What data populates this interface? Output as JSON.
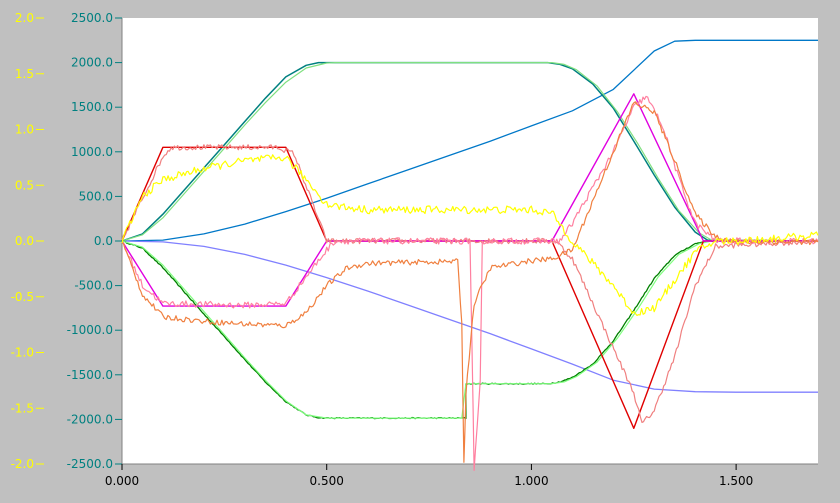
{
  "colors": {
    "background": "#c0c0c0",
    "plot_background": "#ffffff",
    "left_axis_text": "#ffff00",
    "right_axis_text": "#008080",
    "bottom_axis_text": "#000000"
  },
  "chart_data": {
    "type": "line",
    "title": "",
    "xlabel": "",
    "ylabel": "",
    "xlim": [
      0.0,
      1.7
    ],
    "ylim_right": [
      -2500.0,
      2500.0
    ],
    "ylim_left": [
      -2.0,
      2.0
    ],
    "grid": false,
    "legend": "none",
    "x_ticks": [
      "0.000",
      "0.500",
      "1.000",
      "1.500"
    ],
    "x_tick_values": [
      0.0,
      0.5,
      1.0,
      1.5
    ],
    "right_ticks": [
      "2500.0",
      "2000.0",
      "1500.0",
      "1000.0",
      "500.0",
      "0.0",
      "-500.0",
      "-1000.0",
      "-1500.0",
      "-2000.0",
      "-2500.0"
    ],
    "right_tick_values": [
      2500,
      2000,
      1500,
      1000,
      500,
      0,
      -500,
      -1000,
      -1500,
      -2000,
      -2500
    ],
    "left_ticks": [
      "2.0",
      "1.5",
      "1.0",
      "0.5",
      "0.0",
      "-0.5",
      "-1.0",
      "-1.5",
      "-2.0"
    ],
    "left_tick_values": [
      2.0,
      1.5,
      1.0,
      0.5,
      0.0,
      -0.5,
      -1.0,
      -1.5,
      -2.0
    ],
    "series": [
      {
        "color": "#0078c8",
        "noise": 0,
        "width": 1.3,
        "x": [
          0,
          0.1,
          0.2,
          0.3,
          0.4,
          0.5,
          0.6,
          0.7,
          0.8,
          0.9,
          1.0,
          1.1,
          1.2,
          1.3,
          1.35,
          1.4,
          1.5,
          1.7
        ],
        "y": [
          0,
          10,
          80,
          190,
          330,
          480,
          640,
          800,
          960,
          1120,
          1290,
          1460,
          1700,
          2130,
          2240,
          2250,
          2250,
          2250
        ]
      },
      {
        "color": "#8080ff",
        "noise": 0,
        "width": 1.3,
        "x": [
          0,
          0.1,
          0.2,
          0.3,
          0.4,
          0.5,
          0.6,
          0.7,
          0.8,
          0.9,
          1.0,
          1.1,
          1.2,
          1.3,
          1.4,
          1.5,
          1.7
        ],
        "y": [
          0,
          -10,
          -60,
          -150,
          -270,
          -410,
          -560,
          -720,
          -880,
          -1040,
          -1210,
          -1380,
          -1560,
          -1660,
          -1690,
          -1695,
          -1695
        ]
      },
      {
        "color": "#008080",
        "noise": 0,
        "width": 1.5,
        "x": [
          0,
          0.05,
          0.1,
          0.15,
          0.2,
          0.25,
          0.3,
          0.35,
          0.4,
          0.45,
          0.48,
          0.5,
          1.04,
          1.07,
          1.1,
          1.15,
          1.2,
          1.25,
          1.3,
          1.35,
          1.4,
          1.43,
          1.7
        ],
        "y": [
          0,
          80,
          300,
          560,
          820,
          1080,
          1340,
          1600,
          1840,
          1970,
          2000,
          2000,
          2000,
          1980,
          1930,
          1760,
          1490,
          1120,
          740,
          380,
          100,
          10,
          0
        ]
      },
      {
        "color": "#80e080",
        "noise": 0,
        "width": 1.2,
        "x": [
          0,
          0.05,
          0.1,
          0.15,
          0.2,
          0.25,
          0.3,
          0.35,
          0.4,
          0.45,
          0.5,
          0.52,
          1.05,
          1.08,
          1.11,
          1.16,
          1.21,
          1.26,
          1.31,
          1.36,
          1.41,
          1.44,
          1.7
        ],
        "y": [
          0,
          70,
          260,
          520,
          780,
          1040,
          1300,
          1550,
          1780,
          1940,
          1995,
          2000,
          2000,
          1980,
          1920,
          1740,
          1450,
          1090,
          700,
          340,
          90,
          10,
          0
        ]
      },
      {
        "color": "#008000",
        "noise": 6,
        "width": 1.3,
        "x": [
          0,
          0.05,
          0.1,
          0.15,
          0.2,
          0.25,
          0.3,
          0.35,
          0.4,
          0.45,
          0.48,
          0.5,
          0.84,
          0.84,
          1.04,
          1.07,
          1.1,
          1.15,
          1.2,
          1.25,
          1.3,
          1.35,
          1.4,
          1.43,
          1.7
        ],
        "y": [
          0,
          -80,
          -300,
          -560,
          -820,
          -1070,
          -1330,
          -1580,
          -1800,
          -1950,
          -1980,
          -1985,
          -1985,
          -1600,
          -1600,
          -1580,
          -1530,
          -1380,
          -1120,
          -780,
          -420,
          -160,
          -30,
          0,
          0
        ]
      },
      {
        "color": "#80ff80",
        "noise": 0,
        "width": 1.2,
        "x": [
          0,
          0.05,
          0.1,
          0.15,
          0.2,
          0.25,
          0.3,
          0.35,
          0.4,
          0.45,
          0.5,
          0.52,
          0.83,
          0.84,
          1.05,
          1.08,
          1.11,
          1.16,
          1.21,
          1.26,
          1.31,
          1.36,
          1.41,
          1.44,
          1.7
        ],
        "y": [
          0,
          -70,
          -270,
          -530,
          -790,
          -1050,
          -1310,
          -1560,
          -1790,
          -1950,
          -1985,
          -1985,
          -1985,
          -1600,
          -1600,
          -1580,
          -1520,
          -1360,
          -1090,
          -760,
          -400,
          -150,
          -30,
          0,
          0
        ]
      },
      {
        "color": "#e00000",
        "noise": 0,
        "width": 1.4,
        "x": [
          0,
          0.1,
          0.4,
          0.5,
          1.05,
          1.25,
          1.42,
          1.7
        ],
        "y": [
          0,
          1050,
          1050,
          0,
          0,
          -2100,
          0,
          0
        ]
      },
      {
        "color": "#e000e0",
        "noise": 0,
        "width": 1.4,
        "x": [
          0,
          0.1,
          0.4,
          0.5,
          1.05,
          1.25,
          1.42,
          1.7
        ],
        "y": [
          0,
          -730,
          -730,
          0,
          0,
          1650,
          0,
          0
        ]
      },
      {
        "color": "#f08080",
        "noise": 30,
        "width": 1.2,
        "x": [
          0,
          0.1,
          0.12,
          0.38,
          0.42,
          0.5,
          0.52,
          1.06,
          1.1,
          1.25,
          1.27,
          1.3,
          1.35,
          1.4,
          1.45,
          1.7
        ],
        "y": [
          0,
          950,
          1050,
          1050,
          980,
          0,
          0,
          0,
          -200,
          -1700,
          -2050,
          -1900,
          -1300,
          -500,
          -60,
          0
        ]
      },
      {
        "color": "#ff80a0",
        "noise": 35,
        "width": 1.2,
        "x": [
          0,
          0.05,
          0.1,
          0.3,
          0.4,
          0.45,
          0.5,
          0.52,
          0.85,
          0.855,
          0.86,
          0.875,
          0.88,
          1.07,
          1.1,
          1.2,
          1.25,
          1.28,
          1.32,
          1.36,
          1.4,
          1.45,
          1.7
        ],
        "y": [
          0,
          -500,
          -700,
          -720,
          -700,
          -400,
          -100,
          0,
          0,
          -1200,
          -2600,
          -1600,
          0,
          0,
          200,
          1000,
          1500,
          1620,
          1300,
          700,
          200,
          0,
          0
        ]
      },
      {
        "color": "#f08040",
        "noise": 30,
        "width": 1.2,
        "x": [
          0,
          0.05,
          0.1,
          0.2,
          0.3,
          0.4,
          0.45,
          0.5,
          0.55,
          0.6,
          0.8,
          0.82,
          0.83,
          0.835,
          0.84,
          0.86,
          0.9,
          1.0,
          1.05,
          1.1,
          1.2,
          1.25,
          1.3,
          1.35,
          1.4,
          1.45,
          1.5,
          1.7
        ],
        "y": [
          0,
          -600,
          -850,
          -900,
          -930,
          -950,
          -800,
          -500,
          -300,
          -250,
          -230,
          -230,
          -900,
          -2500,
          -1700,
          -700,
          -300,
          -220,
          -200,
          -100,
          1000,
          1550,
          1450,
          900,
          300,
          50,
          -10,
          -10
        ]
      },
      {
        "color": "#ffff00",
        "noise": 0.035,
        "width": 1.2,
        "axis": "left",
        "x": [
          0,
          0.05,
          0.1,
          0.15,
          0.2,
          0.3,
          0.4,
          0.45,
          0.5,
          0.55,
          0.6,
          0.8,
          1.0,
          1.05,
          1.1,
          1.2,
          1.25,
          1.3,
          1.35,
          1.4,
          1.45,
          1.5,
          1.7
        ],
        "y": [
          0,
          0.4,
          0.55,
          0.6,
          0.65,
          0.72,
          0.75,
          0.55,
          0.33,
          0.3,
          0.28,
          0.28,
          0.28,
          0.25,
          0,
          -0.4,
          -0.65,
          -0.6,
          -0.35,
          -0.1,
          0,
          0,
          0.05
        ]
      }
    ]
  }
}
